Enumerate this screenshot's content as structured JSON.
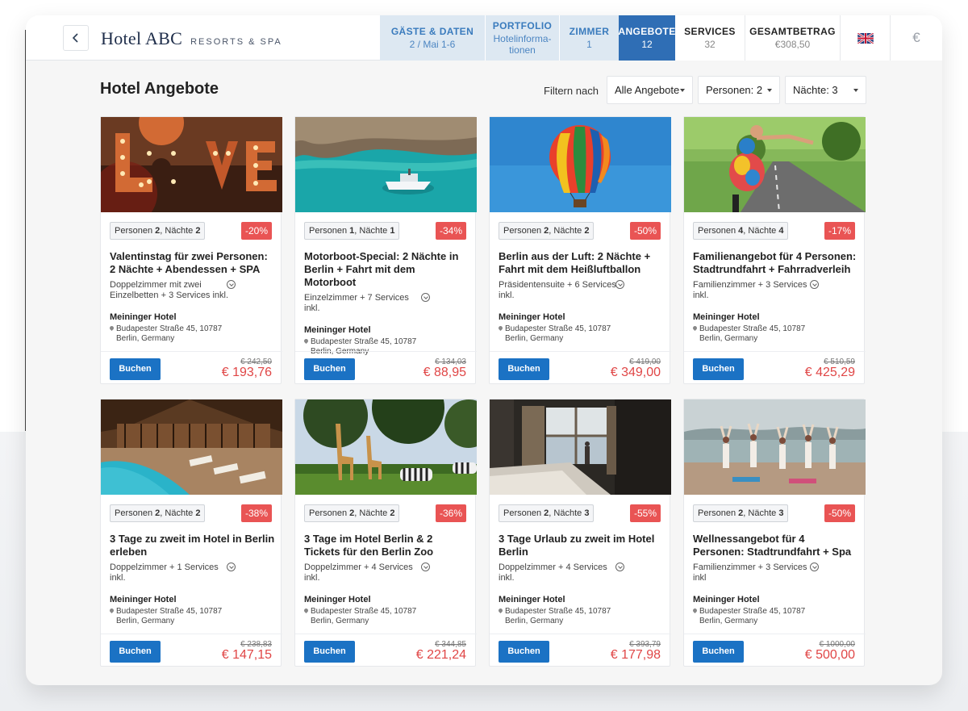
{
  "header": {
    "logo_main": "Hotel ABC",
    "logo_sub": "RESORTS & SPA",
    "nav": [
      {
        "label": "GÄSTE & DATEN",
        "value": "2 / Mai 1-6",
        "state": "done"
      },
      {
        "label": "PORTFOLIO",
        "value": "Hotelinforma-tionen",
        "state": "done"
      },
      {
        "label": "ZIMMER",
        "value": "1",
        "state": "done"
      },
      {
        "label": "ANGEBOTE",
        "value": "12",
        "state": "active"
      },
      {
        "label": "SERVICES",
        "value": "32",
        "state": "todo"
      },
      {
        "label": "GESAMTBETRAG",
        "value": "€308,50",
        "state": "todo"
      }
    ],
    "language_icon": "uk-flag-icon",
    "currency_symbol": "€"
  },
  "toolbar": {
    "title": "Hotel Angebote",
    "filter_label": "Filtern nach",
    "filters": {
      "offers": "Alle Angebote",
      "persons": "Personen: 2",
      "nights": "Nächte: 3"
    }
  },
  "cards": [
    {
      "image": "marquee-love-letters",
      "persons_label": "Personen",
      "persons": "2",
      "nights_label": "Nächte",
      "nights": "2",
      "discount": "-20%",
      "title": "Valentinstag für zwei Personen: 2 Nächte + Abendessen + SPA",
      "rooms": "Doppelzimmer mit zwei Einzelbetten + 3 Services inkl.",
      "hotel": "Meininger Hotel",
      "address1": "Budapester Straße 45, 10787",
      "address2": "Berlin, Germany",
      "book": "Buchen",
      "old_price": "€ 242,50",
      "price": "€ 193,76"
    },
    {
      "image": "motorboat-turquoise-sea",
      "persons_label": "Personen",
      "persons": "1",
      "nights_label": "Nächte",
      "nights": "1",
      "discount": "-34%",
      "title": "Motorboot-Special: 2 Nächte in Berlin + Fahrt mit dem Motorboot",
      "rooms": "Einzelzimmer + 7 Services inkl.",
      "hotel": "Meininger Hotel",
      "address1": "Budapester Straße 45, 10787",
      "address2": "Berlin, Germany",
      "book": "Buchen",
      "old_price": "€ 134,03",
      "price": "€ 88,95"
    },
    {
      "image": "hot-air-balloon",
      "persons_label": "Personen",
      "persons": "2",
      "nights_label": "Nächte",
      "nights": "2",
      "discount": "-50%",
      "title": "Berlin aus der Luft: 2 Nächte + Fahrt mit dem Heißluftballon",
      "rooms": "Präsidentensuite + 6 Services inkl.",
      "hotel": "Meininger Hotel",
      "address1": "Budapester Straße 45, 10787",
      "address2": "Berlin, Germany",
      "book": "Buchen",
      "old_price": "€ 419,00",
      "price": "€ 349,00"
    },
    {
      "image": "family-bike-ride",
      "persons_label": "Personen",
      "persons": "4",
      "nights_label": "Nächte",
      "nights": "4",
      "discount": "-17%",
      "title": "Familienangebot für 4 Personen: Stadtrundfahrt + Fahrradverleih",
      "rooms": "Familienzimmer + 3 Services inkl.",
      "hotel": "Meininger Hotel",
      "address1": "Budapester Straße 45, 10787",
      "address2": "Berlin, Germany",
      "book": "Buchen",
      "old_price": "€ 510,59",
      "price": "€ 425,29"
    },
    {
      "image": "resort-pool-terrace",
      "persons_label": "Personen",
      "persons": "2",
      "nights_label": "Nächte",
      "nights": "2",
      "discount": "-38%",
      "title": "3 Tage zu zweit im Hotel in Berlin erleben",
      "rooms": "Doppelzimmer + 1 Services inkl.",
      "hotel": "Meininger Hotel",
      "address1": "Budapester Straße 45, 10787",
      "address2": "Berlin, Germany",
      "book": "Buchen",
      "old_price": "€ 238,83",
      "price": "€ 147,15"
    },
    {
      "image": "giraffes-zebras-zoo",
      "persons_label": "Personen",
      "persons": "2",
      "nights_label": "Nächte",
      "nights": "2",
      "discount": "-36%",
      "title": "3 Tage im Hotel Berlin & 2 Tickets für den Berlin Zoo",
      "rooms": "Doppelzimmer + 4 Services inkl.",
      "hotel": "Meininger Hotel",
      "address1": "Budapester Straße 45, 10787",
      "address2": "Berlin, Germany",
      "book": "Buchen",
      "old_price": "€ 344,85",
      "price": "€ 221,24"
    },
    {
      "image": "hotel-room-window",
      "persons_label": "Personen",
      "persons": "2",
      "nights_label": "Nächte",
      "nights": "3",
      "discount": "-55%",
      "title": "3 Tage Urlaub zu zweit im Hotel Berlin",
      "rooms": "Doppelzimmer + 4 Services inkl.",
      "hotel": "Meininger Hotel",
      "address1": "Budapester Straße 45, 10787",
      "address2": "Berlin, Germany",
      "book": "Buchen",
      "old_price": "€ 393,79",
      "price": "€ 177,98"
    },
    {
      "image": "beach-yoga-group",
      "persons_label": "Personen",
      "persons": "2",
      "nights_label": "Nächte",
      "nights": "3",
      "discount": "-50%",
      "title": "Wellnessangebot für 4 Personen: Stadtrundfahrt + Spa",
      "rooms": "Familienzimmer + 3 Services inkl",
      "hotel": "Meininger Hotel",
      "address1": "Budapester Straße 45, 10787",
      "address2": "Berlin, Germany",
      "book": "Buchen",
      "old_price": "€ 1000,00",
      "price": "€ 500,00"
    }
  ],
  "colors": {
    "accent": "#2f6eb5",
    "nav_done_bg": "#dde8f2",
    "discount": "#e95454",
    "price": "#e04646",
    "button": "#1b72c4"
  }
}
